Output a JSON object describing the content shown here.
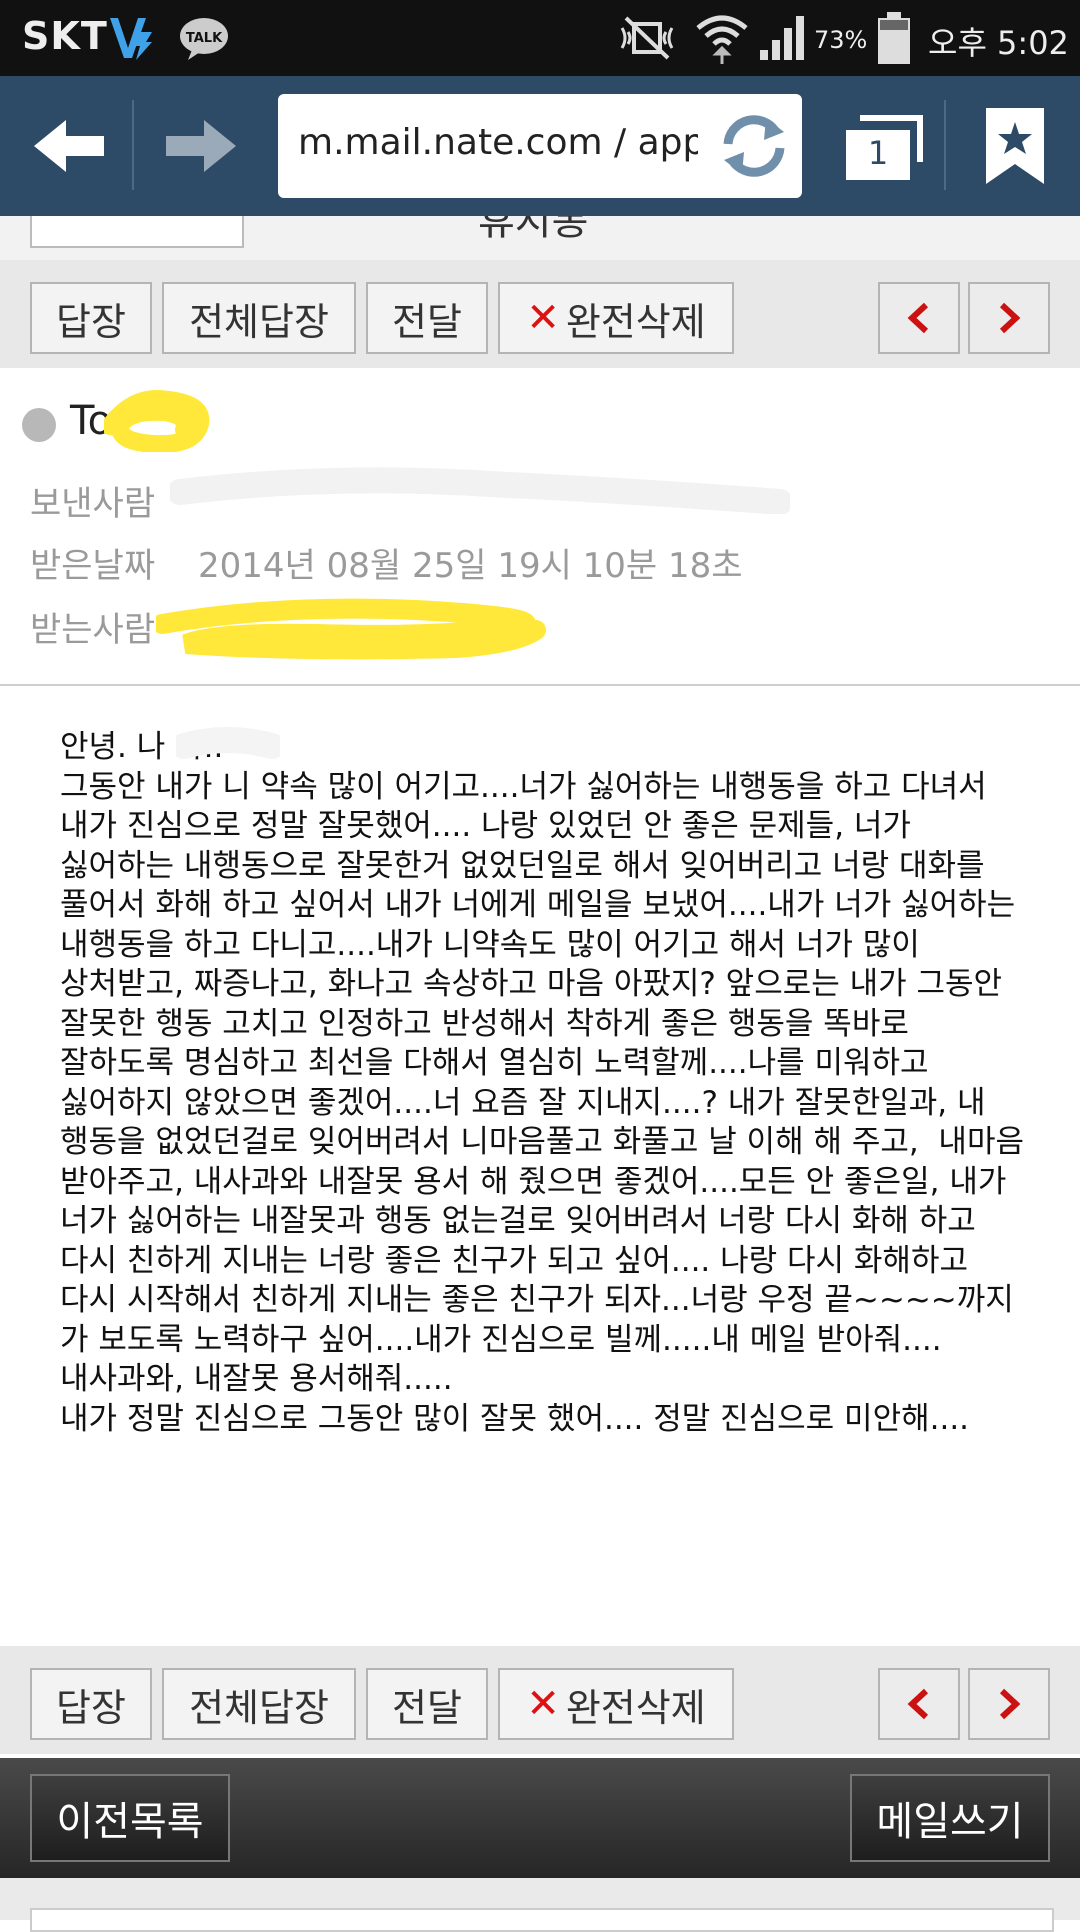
{
  "status_bar": {
    "carrier": "SKT",
    "battery_percent": "73%",
    "time": "오후 5:02",
    "icons": [
      "v-icon",
      "kakaotalk-icon",
      "mute-icon",
      "wifi-icon",
      "signal-icon",
      "battery-icon"
    ]
  },
  "browser": {
    "url": "m.mail.nate.com / app / m",
    "tab_count": "1",
    "icons": [
      "back-arrow-icon",
      "forward-arrow-icon",
      "refresh-icon",
      "tabs-icon",
      "bookmark-star-icon"
    ]
  },
  "partial_header": {
    "title": "휴지통"
  },
  "actions": {
    "reply": "답장",
    "reply_all": "전체답장",
    "forward": "전달",
    "delete_permanent": "완전삭제",
    "delete_icon": "x-icon",
    "prev_icon": "chevron-left-icon",
    "next_icon": "chevron-right-icon"
  },
  "mail_header": {
    "to_label": "To:",
    "sender_label": "보낸사람",
    "date_label": "받은날짜",
    "date_value": "2014년 08월 25일 19시 10분 18초",
    "recipient_label": "받는사람"
  },
  "mail_body": {
    "text": "안녕. 나 야..\n그동안 내가 니 약속 많이 어기고....너가 싫어하는 내행동을 하고 다녀서 내가 진심으로 정말 잘못했어.... 나랑 있었던 안 좋은 문제들, 너가 싫어하는 내행동으로 잘못한거 없었던일로 해서 잊어버리고 너랑 대화를 풀어서 화해 하고 싶어서 내가 너에게 메일을 보냈어....내가 너가 싫어하는 내행동을 하고 다니고....내가 니약속도 많이 어기고 해서 너가 많이 상처받고, 짜증나고, 화나고 속상하고 마음 아팠지? 앞으로는 내가 그동안 잘못한 행동 고치고 인정하고 반성해서 착하게 좋은 행동을 똑바로 잘하도록 명심하고 최선을 다해서 열심히 노력할께....나를 미워하고 싫어하지 않았으면 좋겠어....너 요즘 잘 지내지....? 내가 잘못한일과, 내 행동을 없었던걸로 잊어버려서 니마음풀고 화풀고 날 이해 해 주고,  내마음 받아주고, 내사과와 내잘못 용서 해 줬으면 좋겠어....모든 안 좋은일, 내가 너가 싫어하는 내잘못과 행동 없는걸로 잊어버려서 너랑 다시 화해 하고 다시 친하게 지내는 너랑 좋은 친구가 되고 싶어.... 나랑 다시 화해하고 다시 시작해서 친하게 지내는 좋은 친구가 되자...너랑 우정 끝~~~~까지 가 보도록 노력하구 싶어....내가 진심으로 빌께.....내 메일 받아줘....내사과와, 내잘못 용서해줘.....\n내가 정말 진심으로 그동안 많이 잘못 했어.... 정말 진심으로 미안해...."
  },
  "bottom_bar": {
    "prev_list": "이전목록",
    "compose": "메일쓰기"
  },
  "colors": {
    "browser_bar": "#2d4a66",
    "action_bar": "#e8e8e8",
    "delete_x": "#dd1111",
    "nav_chevron": "#cc1111",
    "redaction_yellow": "#ffe83a"
  }
}
